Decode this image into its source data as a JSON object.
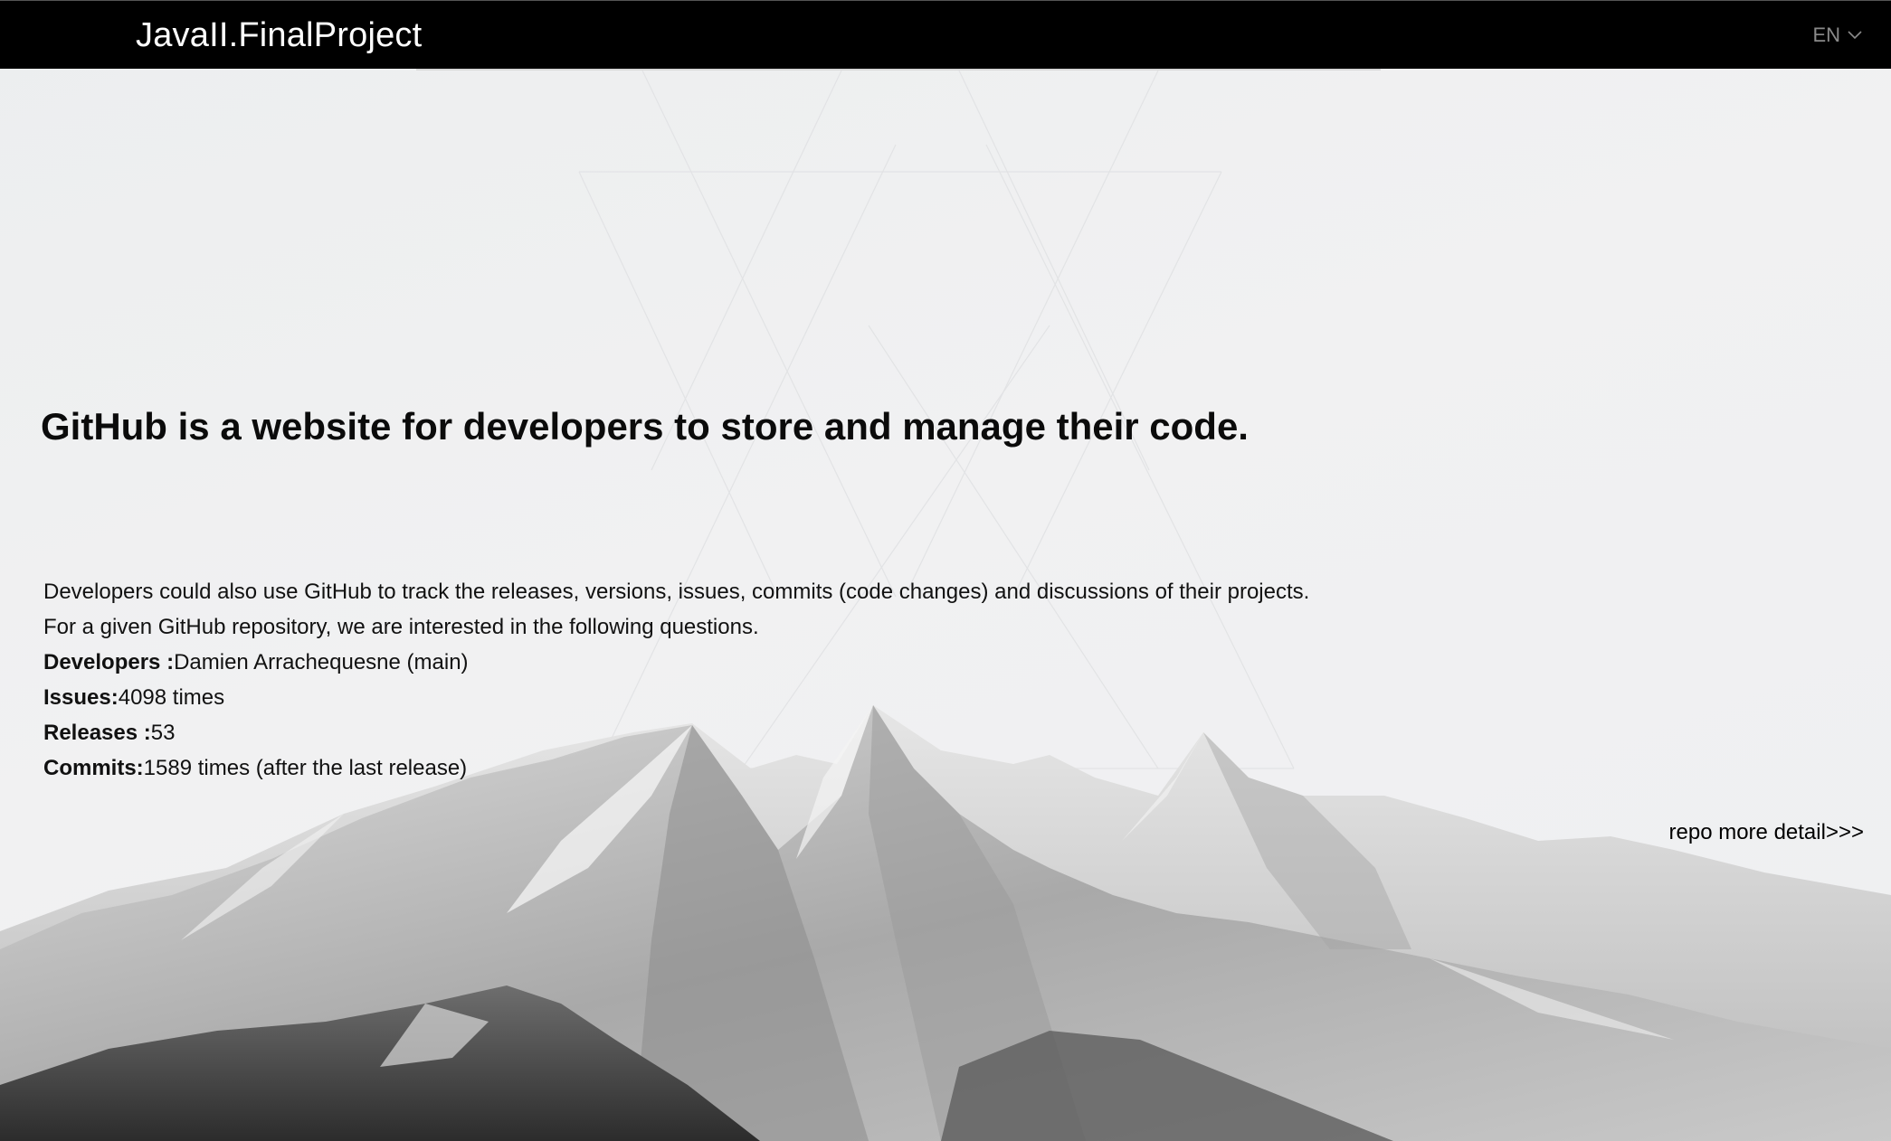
{
  "navbar": {
    "brand": "JavaII.FinalProject",
    "language": "EN"
  },
  "hero": {
    "headline": "GitHub is a website for developers to store and manage their code."
  },
  "description": {
    "line1": "Developers could also use GitHub to track the releases, versions, issues, commits (code changes) and discussions of their projects.",
    "line2": "For a given GitHub repository, we are interested in the following questions.",
    "stats": [
      {
        "label": "Developers :",
        "value": "Damien Arrachequesne (main)"
      },
      {
        "label": "Issues:",
        "value": "4098 times"
      },
      {
        "label": "Releases :",
        "value": "53"
      },
      {
        "label": "Commits:",
        "value": "1589 times (after the last release)"
      }
    ]
  },
  "more_link": "repo more detail>>>",
  "icons": {
    "language_dropdown": "chevron-down-icon"
  },
  "colors": {
    "navbar_bg": "#000000",
    "page_bg": "#eeeff1",
    "text": "#111111",
    "lang_text": "#8a8a8a"
  }
}
